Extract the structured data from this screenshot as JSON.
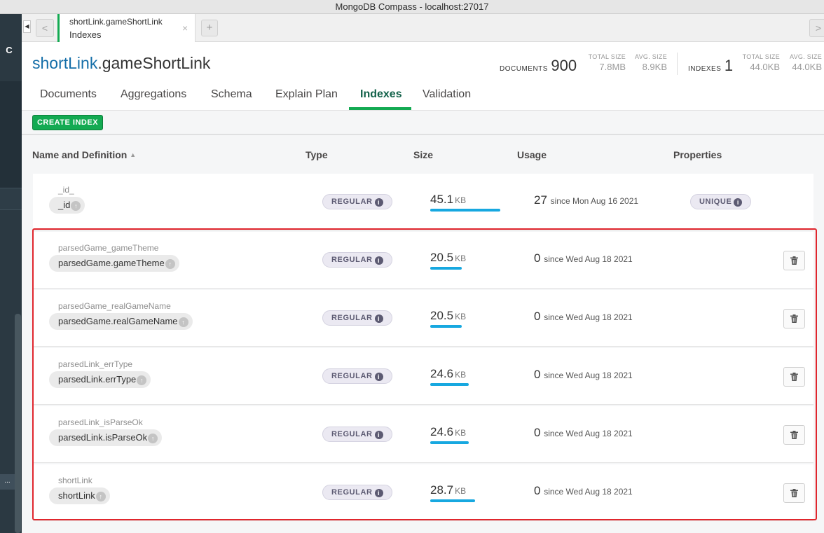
{
  "window": {
    "title": "MongoDB Compass - localhost:27017"
  },
  "sidebar": {
    "refresh_icon": "refresh-icon",
    "more_label": "..."
  },
  "tab": {
    "namespace": "shortLink.gameShortLink",
    "subtitle": "Indexes",
    "close": "×",
    "add": "+",
    "back": "<",
    "forward": ">",
    "left_arrow": "◀"
  },
  "header": {
    "db": "shortLink",
    "collection": ".gameShortLink",
    "documents_label": "DOCUMENTS",
    "documents_count": "900",
    "doc_total_size_label": "TOTAL SIZE",
    "doc_total_size": "7.8MB",
    "doc_avg_size_label": "AVG. SIZE",
    "doc_avg_size": "8.9KB",
    "indexes_label": "INDEXES",
    "indexes_count": "1",
    "idx_total_size_label": "TOTAL SIZE",
    "idx_total_size": "44.0KB",
    "idx_avg_size_label": "AVG. SIZE",
    "idx_avg_size": "44.0KB"
  },
  "tabs": [
    "Documents",
    "Aggregations",
    "Schema",
    "Explain Plan",
    "Indexes",
    "Validation"
  ],
  "toolbar": {
    "create_index": "CREATE INDEX"
  },
  "columns": {
    "name": "Name and Definition",
    "sort_icon": "▲",
    "type": "Type",
    "size": "Size",
    "usage": "Usage",
    "properties": "Properties"
  },
  "indexes": [
    {
      "name": "_id_",
      "field": "_id",
      "type": "REGULAR",
      "size": "45.1",
      "unit": "KB",
      "size_fraction": 1.0,
      "usage": "27",
      "since": "since Mon Aug 16 2021",
      "property": "UNIQUE",
      "deletable": false
    },
    {
      "name": "parsedGame_gameTheme",
      "field": "parsedGame.gameTheme",
      "type": "REGULAR",
      "size": "20.5",
      "unit": "KB",
      "size_fraction": 0.45,
      "usage": "0",
      "since": "since Wed Aug 18 2021",
      "property": "",
      "deletable": true
    },
    {
      "name": "parsedGame_realGameName",
      "field": "parsedGame.realGameName",
      "type": "REGULAR",
      "size": "20.5",
      "unit": "KB",
      "size_fraction": 0.45,
      "usage": "0",
      "since": "since Wed Aug 18 2021",
      "property": "",
      "deletable": true
    },
    {
      "name": "parsedLink_errType",
      "field": "parsedLink.errType",
      "type": "REGULAR",
      "size": "24.6",
      "unit": "KB",
      "size_fraction": 0.55,
      "usage": "0",
      "since": "since Wed Aug 18 2021",
      "property": "",
      "deletable": true
    },
    {
      "name": "parsedLink_isParseOk",
      "field": "parsedLink.isParseOk",
      "type": "REGULAR",
      "size": "24.6",
      "unit": "KB",
      "size_fraction": 0.55,
      "usage": "0",
      "since": "since Wed Aug 18 2021",
      "property": "",
      "deletable": true
    },
    {
      "name": "shortLink",
      "field": "shortLink",
      "type": "REGULAR",
      "size": "28.7",
      "unit": "KB",
      "size_fraction": 0.64,
      "usage": "0",
      "since": "since Wed Aug 18 2021",
      "property": "",
      "deletable": true
    }
  ],
  "colors": {
    "accent": "#13aa52",
    "bar": "#17a8e0",
    "highlight": "#e0262d",
    "db_link": "#146ea8"
  }
}
